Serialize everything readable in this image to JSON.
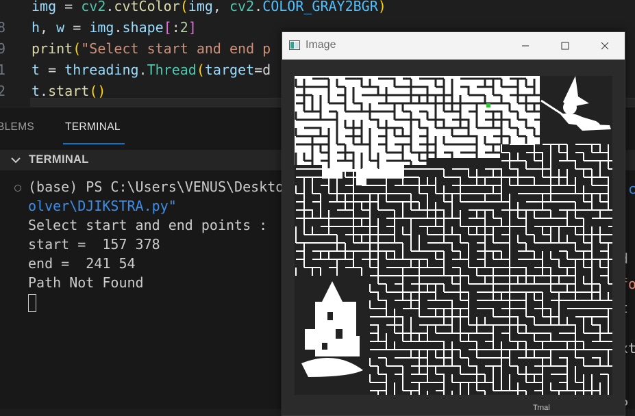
{
  "editor": {
    "lines": [
      {
        "num": "",
        "tokens": [
          [
            "var",
            "img"
          ],
          [
            "op",
            " = "
          ],
          [
            "cls",
            "cv2"
          ],
          [
            "op",
            "."
          ],
          [
            "fn",
            "cvtColor"
          ],
          [
            "paren",
            "("
          ],
          [
            "var",
            "img"
          ],
          [
            "op",
            ", "
          ],
          [
            "cls",
            "cv2"
          ],
          [
            "op",
            "."
          ],
          [
            "const",
            "COLOR_GRAY2BGR"
          ],
          [
            "paren",
            ")"
          ]
        ]
      },
      {
        "num": "8",
        "tokens": [
          [
            "var",
            "h"
          ],
          [
            "op",
            ", "
          ],
          [
            "var",
            "w"
          ],
          [
            "op",
            " = "
          ],
          [
            "var",
            "img"
          ],
          [
            "op",
            "."
          ],
          [
            "var",
            "shape"
          ],
          [
            "bracket",
            "["
          ],
          [
            "op",
            ":"
          ],
          [
            "num",
            "2"
          ],
          [
            "bracket",
            "]"
          ]
        ]
      },
      {
        "num": "9",
        "tokens": [
          [
            "fn",
            "print"
          ],
          [
            "paren",
            "("
          ],
          [
            "str",
            "\"Select start and end p"
          ]
        ]
      },
      {
        "num": "1",
        "tokens": [
          [
            "var",
            "t"
          ],
          [
            "op",
            " = "
          ],
          [
            "var",
            "threading"
          ],
          [
            "op",
            "."
          ],
          [
            "cls",
            "Thread"
          ],
          [
            "paren",
            "("
          ],
          [
            "var",
            "target"
          ],
          [
            "op",
            "=d"
          ]
        ]
      },
      {
        "num": "2",
        "tokens": [
          [
            "var",
            "t"
          ],
          [
            "op",
            "."
          ],
          [
            "fn",
            "start"
          ],
          [
            "paren",
            "()"
          ]
        ]
      }
    ]
  },
  "panel": {
    "tab_problems": "BLEMS",
    "tab_terminal": "TERMINAL",
    "terminal_section_title": "TERMINAL",
    "terminal_lines": [
      {
        "text": "(base) PS C:\\Users\\VENUS\\Deskto",
        "style": "normal"
      },
      {
        "text": "olver\\DJIKSTRA.py\"",
        "style": "path"
      },
      {
        "text": "Select start and end points :",
        "style": "normal"
      },
      {
        "text": "start =  157 378",
        "style": "normal"
      },
      {
        "text": "end =  241 54",
        "style": "normal"
      },
      {
        "text": "Path Not Found",
        "style": "normal"
      }
    ]
  },
  "right_fragments": [
    {
      "text": "'c",
      "color": "#3b8eea"
    },
    {
      "text": "d",
      "color": "#cccccc"
    },
    {
      "text": "fo",
      "color": "#f48771"
    },
    {
      "text": "t",
      "color": "#cccccc"
    },
    {
      "text": "xt",
      "color": "#cccccc"
    },
    {
      "text": "P",
      "color": "#cccccc"
    }
  ],
  "image_window": {
    "title": "Image",
    "status": "Trnal"
  },
  "colors": {
    "accent": "#0078d4",
    "maze_wall": "#ffffff",
    "maze_bg": "#222222",
    "start_marker": "#22cc22"
  }
}
